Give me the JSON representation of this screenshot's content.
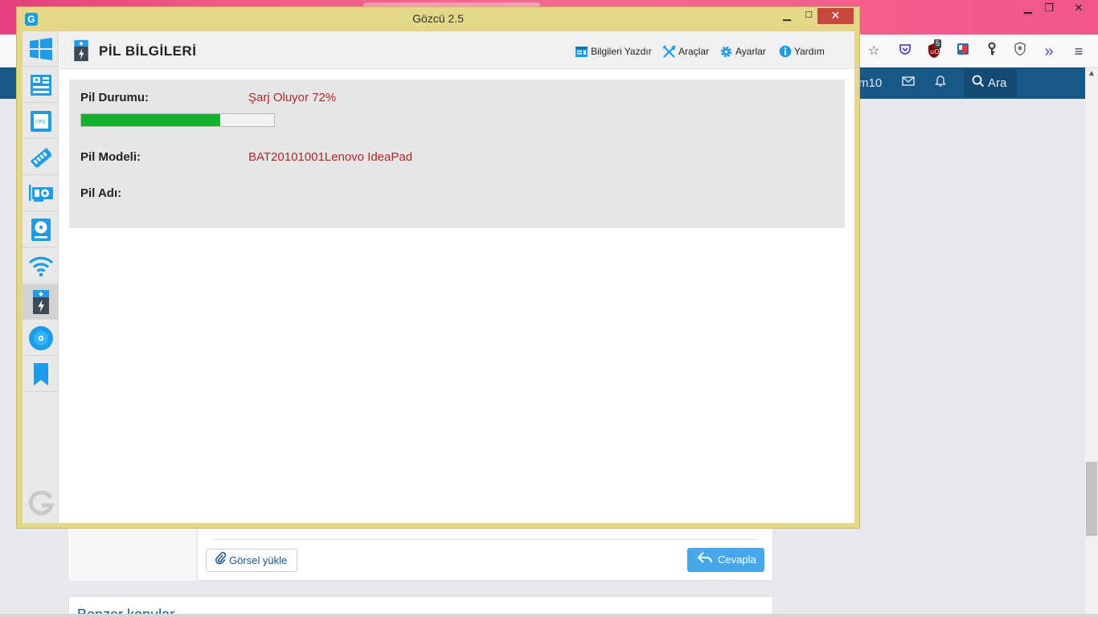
{
  "app": {
    "title": "Gözcü 2.5",
    "logo_letter": "G",
    "window_controls": {
      "minimize": "▁",
      "maximize": "☐",
      "close": "✕"
    }
  },
  "header": {
    "title": "PİL BİLGİLERİ",
    "actions": [
      {
        "label": "Bilgileri Yazdır",
        "icon": "print-info-icon"
      },
      {
        "label": "Araçlar",
        "icon": "tools-icon"
      },
      {
        "label": "Ayarlar",
        "icon": "gear-icon"
      },
      {
        "label": "Yardım",
        "icon": "info-icon"
      }
    ]
  },
  "sidebar": {
    "items": [
      {
        "icon": "windows-icon"
      },
      {
        "icon": "motherboard-icon"
      },
      {
        "icon": "cpu-icon",
        "text": "CPU"
      },
      {
        "icon": "ram-icon"
      },
      {
        "icon": "graphics-card-icon"
      },
      {
        "icon": "hard-disk-icon"
      },
      {
        "icon": "wifi-icon"
      },
      {
        "icon": "battery-icon",
        "active": true
      },
      {
        "icon": "optical-disc-icon"
      },
      {
        "icon": "bookmark-icon"
      }
    ]
  },
  "battery": {
    "status_label": "Pil Durumu:",
    "status_value": "Şarj Oluyor 72%",
    "charge_percent": 72,
    "model_label": "Pil Modeli:",
    "model_value": "BAT20101001Lenovo IdeaPad",
    "name_label": "Pil Adı:",
    "name_value": ""
  },
  "colors": {
    "window_border": "#e3d887",
    "close_button": "#c7463d",
    "value_text": "#b1272a",
    "battery_fill": "#16b22d",
    "accent_blue": "#1e9cea"
  },
  "background_page": {
    "nav_user": "m10",
    "search_label": "Ara",
    "upload_button": "Görsel yükle",
    "reply_button": "Cevapla",
    "similar_title": "Benzer konular",
    "extension_badge": "5"
  }
}
